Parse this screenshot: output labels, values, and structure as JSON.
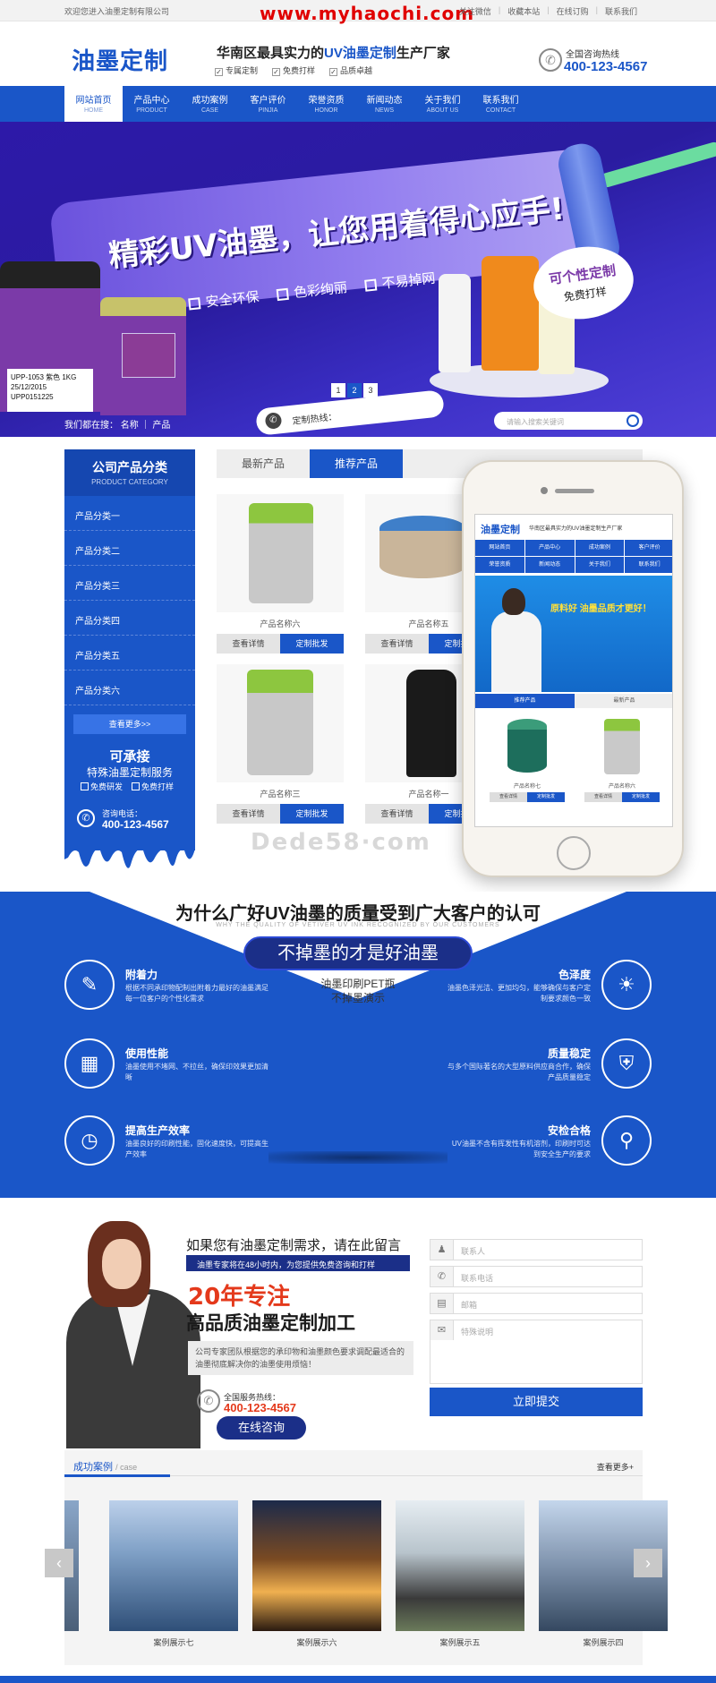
{
  "topbar": {
    "welcome": "欢迎您进入油墨定制有限公司",
    "watermark": "www.myhaochi.com",
    "links": [
      "关注微信",
      "收藏本站",
      "在线订购",
      "联系我们"
    ]
  },
  "header": {
    "logo": "油墨定制",
    "slogan_prefix": "华南区最具实力的",
    "slogan_highlight": "UV油墨定制",
    "slogan_suffix": "生产厂家",
    "checks": [
      "专属定制",
      "免费打样",
      "品质卓越"
    ],
    "hotline_label": "全国咨询热线",
    "hotline_number": "400-123-4567"
  },
  "nav": [
    {
      "cn": "网站首页",
      "en": "HOME",
      "active": true
    },
    {
      "cn": "产品中心",
      "en": "PRODUCT"
    },
    {
      "cn": "成功案例",
      "en": "CASE"
    },
    {
      "cn": "客户评价",
      "en": "PINJIA"
    },
    {
      "cn": "荣誉资质",
      "en": "HONOR"
    },
    {
      "cn": "新闻动态",
      "en": "NEWS"
    },
    {
      "cn": "关于我们",
      "en": "ABOUT US"
    },
    {
      "cn": "联系我们",
      "en": "CONTACT"
    }
  ],
  "banner": {
    "title": "精彩UV油墨，让您用着得心应手!",
    "points": [
      "安全环保",
      "色彩绚丽",
      "不易掉网"
    ],
    "hotline": "定制热线：",
    "badge_line1": "可个性定制",
    "badge_line2": "免费打样",
    "can_label": "UPP-1053 紫色 1KG 25/12/2015 UPP0151225",
    "dots": [
      "1",
      "2",
      "3"
    ],
    "active_dot": "2",
    "search_label": "我们都在搜：  名称  ｜  产品",
    "search_placeholder": "请输入搜索关键词"
  },
  "category": {
    "title": "公司产品分类",
    "subtitle": "PRODUCT CATEGORY",
    "items": [
      "产品分类一",
      "产品分类二",
      "产品分类三",
      "产品分类四",
      "产品分类五",
      "产品分类六"
    ],
    "more": "查看更多>>",
    "promo_title": "可承接",
    "promo_sub": "特殊油墨定制服务",
    "promo_points": [
      "免费研发",
      "免费打样"
    ],
    "phone_label": "咨询电话：",
    "phone_number": "400-123-4567"
  },
  "products": {
    "tabs": [
      "最新产品",
      "推荐产品"
    ],
    "active_tab": "推荐产品",
    "items": [
      {
        "name": "产品名称六"
      },
      {
        "name": "产品名称五"
      },
      {
        "name": "产品名称三"
      },
      {
        "name": "产品名称一"
      }
    ],
    "btn_detail": "查看详情",
    "btn_custom": "定制批发"
  },
  "phone_mock": {
    "logo": "油墨定制",
    "slogan": "华南区最具实力的UV油墨定制生产厂家",
    "nav": [
      "网站首页",
      "产品中心",
      "成功案例",
      "客户评价",
      "荣誉资质",
      "新闻动态",
      "关于我们",
      "联系我们"
    ],
    "banner_text": "原料好 油墨品质才更好！",
    "tabs": [
      "推荐产品",
      "最新产品"
    ],
    "items": [
      {
        "name": "产品名称七"
      },
      {
        "name": "产品名称六"
      }
    ],
    "btn_detail": "查看详情",
    "btn_custom": "定制批发"
  },
  "watermark2": "Dede58·com",
  "why": {
    "title": "为什么广好UV油墨的质量受到广大客户的认可",
    "subtitle": "WHY THE QUALITY OF VETIVER UV INK RECOGNIZED BY OUR CUSTOMERS",
    "pill": "不掉墨的才是好油墨",
    "caption1": "油墨印刷PET瓶",
    "caption2": "不掉墨演示",
    "features_left": [
      {
        "title": "附着力",
        "desc": "根据不同承印物配制出附着力最好的油墨满足每一位客户的个性化需求",
        "icon": "pencil-icon",
        "glyph": "✎"
      },
      {
        "title": "使用性能",
        "desc": "油墨使用不堵网、不拉丝，确保印效果更加清晰",
        "icon": "box-icon",
        "glyph": "▦"
      },
      {
        "title": "提高生产效率",
        "desc": "油墨良好的印刷性能，固化速度快，可提高生产效率",
        "icon": "clock-icon",
        "glyph": "◷"
      }
    ],
    "features_right": [
      {
        "title": "色泽度",
        "desc": "油墨色泽光洁、更加均匀，能够确保与客户定制要求颜色一致",
        "icon": "sun-icon",
        "glyph": "☀"
      },
      {
        "title": "质量稳定",
        "desc": "与多个国际著名的大型原料供应商合作，确保产品质量稳定",
        "icon": "shield-icon",
        "glyph": "⛨"
      },
      {
        "title": "安检合格",
        "desc": "UV油墨不含有挥发性有机溶剂，印刷时可达到安全生产的要求",
        "icon": "magnifier-icon",
        "glyph": "⚲"
      }
    ]
  },
  "contact": {
    "question": "如果您有油墨定制需求，请在此留言",
    "strip": "油墨专家将在48小时内，为您提供免费咨询和打样",
    "years": "20年专注",
    "headline": "高品质油墨定制加工",
    "desc": "公司专家团队根据您的承印物和油墨颜色要求调配最适合的油墨彻底解决你的油墨使用烦恼！",
    "service_label": "全国服务热线：",
    "service_number": "400-123-4567",
    "online_btn": "在线咨询",
    "form": {
      "name_ph": "联系人",
      "phone_ph": "联系电话",
      "email_ph": "邮箱",
      "msg_ph": "特殊说明",
      "submit": "立即提交"
    }
  },
  "cases": {
    "title": "成功案例",
    "title_en": "/ case",
    "more": "查看更多+",
    "items": [
      {
        "caption": "案例展示七"
      },
      {
        "caption": "案例展示六"
      },
      {
        "caption": "案例展示五"
      },
      {
        "caption": "案例展示四"
      }
    ],
    "prev": "‹",
    "next": "›"
  }
}
